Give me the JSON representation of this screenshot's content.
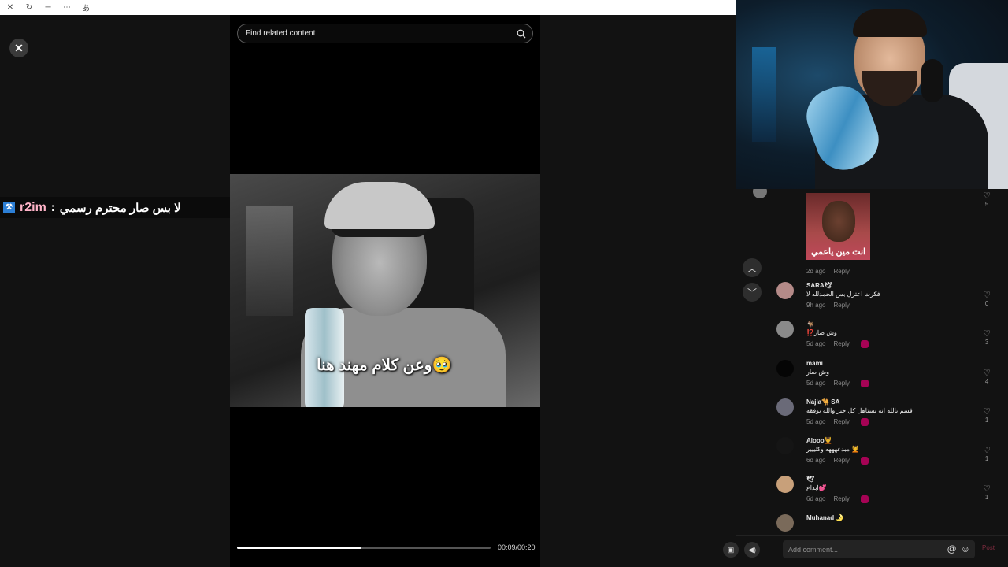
{
  "topbar": {
    "icons": [
      "close-icon",
      "refresh-icon",
      "minimize-icon",
      "more-icon",
      "translate-icon"
    ],
    "glyphs": [
      "✕",
      "↻",
      "─",
      "⋯",
      "あ"
    ]
  },
  "left": {
    "close_glyph": "✕"
  },
  "banner": {
    "user": "r2im",
    "separator": " : ",
    "message": "لا بس صار محترم رسمي"
  },
  "player": {
    "search_placeholder": "Find related content",
    "caption": "وعن كلام مهند هنا🥹",
    "progress": 0.49,
    "time": "00:09/00:20"
  },
  "comments": [
    {
      "name": "",
      "text": "",
      "meta_time": "2d ago",
      "meta_reply": "Reply",
      "likes": "5",
      "meme_text": "انت مين ياعمي"
    },
    {
      "name": "SARA🕊",
      "text": "فكرت اعتزل بس الحمدلله لا",
      "meta_time": "9h ago",
      "meta_reply": "Reply",
      "likes": "0"
    },
    {
      "name": "🐐",
      "text": "وش صار⁉️",
      "meta_time": "5d ago",
      "meta_reply": "Reply",
      "likes": "3"
    },
    {
      "name": "mami",
      "text": "وش صار",
      "meta_time": "5d ago",
      "meta_reply": "Reply",
      "likes": "4"
    },
    {
      "name": "Najla🐪 SA",
      "text": "قسم بالله انه يستاهل كل خير والله يوفقه",
      "meta_time": "5d ago",
      "meta_reply": "Reply",
      "likes": "1"
    },
    {
      "name": "Alooo💆",
      "text": "💆 مبدعهههه وكثييير",
      "meta_time": "6d ago",
      "meta_reply": "Reply",
      "likes": "1"
    },
    {
      "name": "🕊",
      "text": "💕ابداع",
      "meta_time": "6d ago",
      "meta_reply": "Reply",
      "likes": "1"
    },
    {
      "name": "Muhanad 🌛",
      "text": "",
      "meta_time": "",
      "meta_reply": "",
      "likes": ""
    }
  ],
  "bottom": {
    "comment_placeholder": "Add comment...",
    "post_label": "Post",
    "at_glyph": "@",
    "emoji_glyph": "☺"
  },
  "colors": {
    "banner_user": "#ffb3c8",
    "post": "#c43c5c",
    "reaction": "#cc0066"
  }
}
